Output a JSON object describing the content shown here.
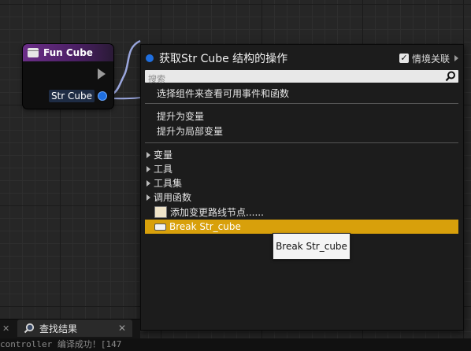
{
  "node": {
    "title": "Fun Cube",
    "pin_label": "Str Cube"
  },
  "menu": {
    "title": "获取Str Cube 结构的操作",
    "context_label": "情境关联",
    "search_placeholder": "搜索",
    "info_text": "选择组件来查看可用事件和函数",
    "promote_variable": "提升为变量",
    "promote_local_variable": "提升为局部变量",
    "categories": [
      "变量",
      "工具",
      "工具集",
      "调用函数"
    ],
    "reroute_node": "添加变更路线节点......",
    "break_item": "Break Str_cube"
  },
  "tooltip": "Break Str_cube",
  "bottom": {
    "tab_label": "查找结果",
    "log_text": "controller 编译成功！[147"
  },
  "colors": {
    "accent_selected": "#d8a00b",
    "node_header": "#6b2e88",
    "pin_blue": "#1f6fe0"
  }
}
